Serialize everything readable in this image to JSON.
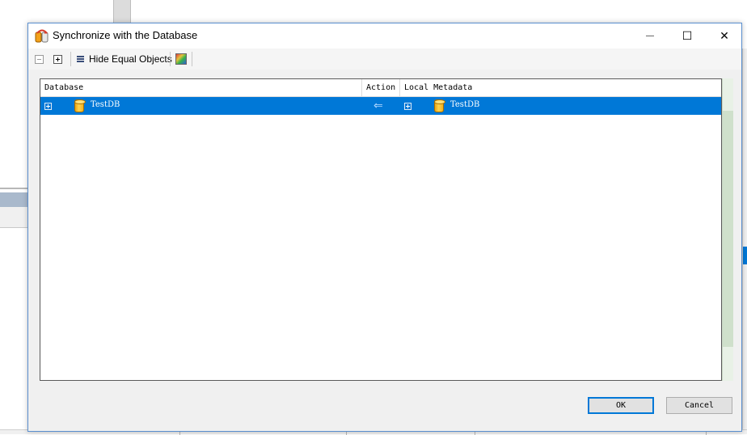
{
  "window": {
    "title": "Synchronize with the Database",
    "minimize_glyph": "—",
    "maximize_glyph": "☐",
    "close_glyph": "✕"
  },
  "toolbar": {
    "collapse_icon": "collapse-all-icon",
    "expand_icon": "expand-all-icon",
    "hide_equal_label": "Hide Equal Objects",
    "color_icon": "color-palette-icon"
  },
  "grid": {
    "columns": [
      "Database",
      "Action",
      "Local Metadata"
    ],
    "rows": [
      {
        "database": "TestDB",
        "action_icon": "left-arrow-icon",
        "local_metadata": "TestDB",
        "selected": true
      }
    ]
  },
  "buttons": {
    "ok": "OK",
    "cancel": "Cancel"
  },
  "colors": {
    "selection": "#0078d7",
    "window_border": "#5a8fcf",
    "dialog_bg": "#f0f0f0"
  }
}
